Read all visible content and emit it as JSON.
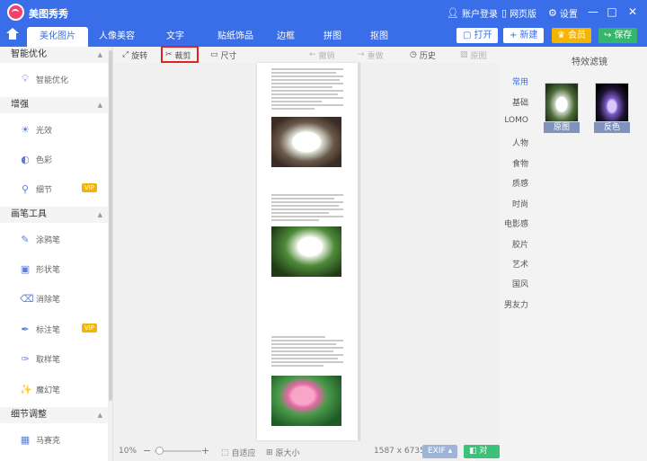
{
  "titlebar": {
    "app_title": "美图秀秀",
    "account": "账户登录",
    "web_version": "网页版",
    "settings": "设置"
  },
  "tabs": [
    {
      "label": "美化图片",
      "active": true
    },
    {
      "label": "人像美容",
      "active": false
    },
    {
      "label": "文字",
      "active": false
    },
    {
      "label": "贴纸饰品",
      "active": false
    },
    {
      "label": "边框",
      "active": false
    },
    {
      "label": "拼图",
      "active": false
    },
    {
      "label": "抠图",
      "active": false
    }
  ],
  "actions": {
    "open": "打开",
    "new": "新建",
    "vip": "会员",
    "save": "保存"
  },
  "left_panel": {
    "sections": [
      {
        "title": "智能优化",
        "items": [
          {
            "label": "智能优化"
          }
        ]
      },
      {
        "title": "增强",
        "items": [
          {
            "label": "光效"
          },
          {
            "label": "色彩"
          },
          {
            "label": "细节",
            "badge": "VIP"
          }
        ]
      },
      {
        "title": "画笔工具",
        "items": [
          {
            "label": "涂鸦笔"
          },
          {
            "label": "形状笔"
          },
          {
            "label": "消除笔"
          },
          {
            "label": "标注笔",
            "badge": "VIP"
          },
          {
            "label": "取样笔"
          },
          {
            "label": "魔幻笔"
          }
        ]
      },
      {
        "title": "细节调整",
        "items": [
          {
            "label": "马赛克"
          }
        ]
      }
    ]
  },
  "toolbar": {
    "rotate": "旋转",
    "crop": "裁剪",
    "size": "尺寸",
    "undo": "撤销",
    "redo": "重做",
    "history": "历史",
    "original": "原图"
  },
  "statusbar": {
    "zoom": "10%",
    "zoom_level": 0.1,
    "fit": "自适应",
    "actual_size": "原大小",
    "dimensions": "1587 x 6735",
    "exif": "EXIF",
    "compare": "对比"
  },
  "categories": [
    {
      "label": "常用",
      "active": true
    },
    {
      "label": "基础"
    },
    {
      "label": "LOMO"
    },
    {
      "label": "人物"
    },
    {
      "label": "食物"
    },
    {
      "label": "质感"
    },
    {
      "label": "时尚"
    },
    {
      "label": "电影感"
    },
    {
      "label": "胶片"
    },
    {
      "label": "艺术"
    },
    {
      "label": "国风"
    },
    {
      "label": "男友力"
    }
  ],
  "filters": {
    "title": "特效滤镜",
    "items": [
      {
        "label": "原图"
      },
      {
        "label": "反色"
      }
    ]
  },
  "colors": {
    "accent": "#3a6ee8",
    "vip": "#f5b400",
    "save": "#36b56c",
    "crop_highlight": "#e0231c"
  }
}
